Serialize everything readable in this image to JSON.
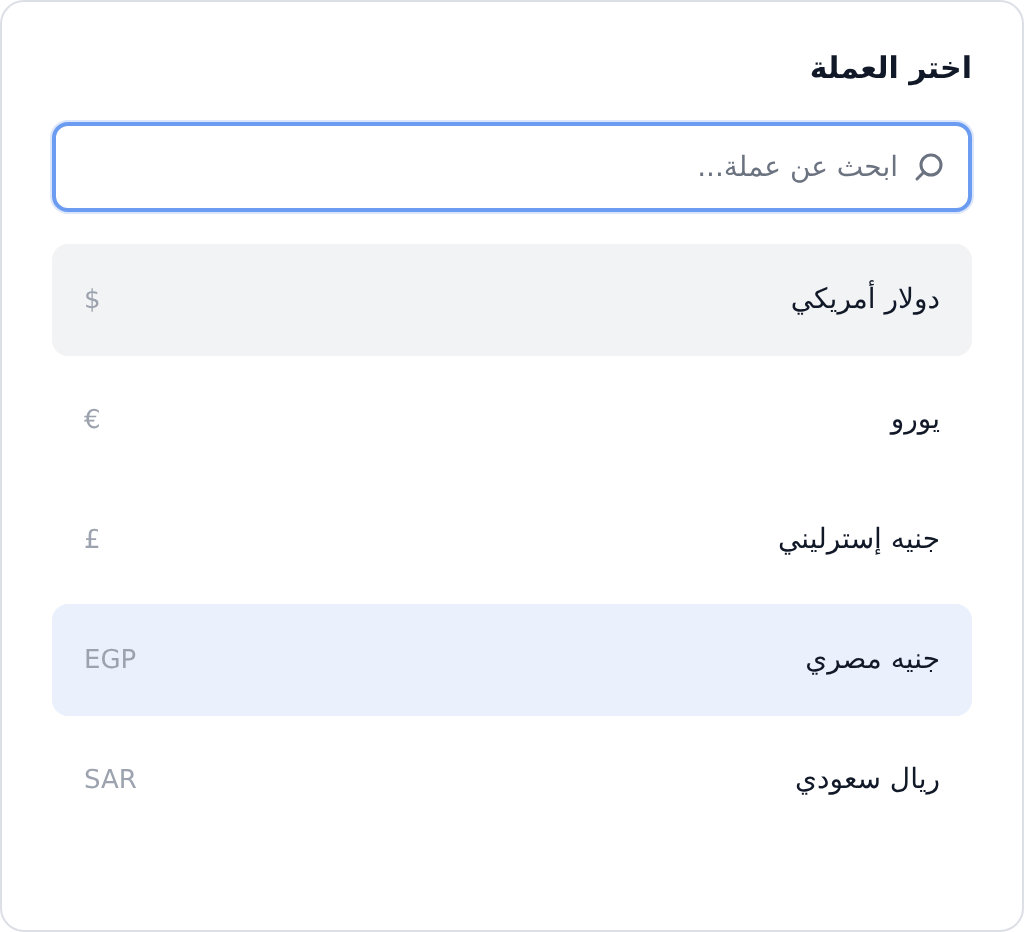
{
  "dialog": {
    "title": "اختر العملة"
  },
  "search": {
    "placeholder": "ابحث عن عملة..."
  },
  "currencies": [
    {
      "name": "دولار أمريكي",
      "symbol": "$",
      "selected": false,
      "hovered": true
    },
    {
      "name": "يورو",
      "symbol": "€",
      "selected": false,
      "hovered": false
    },
    {
      "name": "جنيه إسترليني",
      "symbol": "£",
      "selected": false,
      "hovered": false
    },
    {
      "name": "جنيه مصري",
      "symbol": "EGP",
      "selected": true,
      "hovered": false
    },
    {
      "name": "ريال سعودي",
      "symbol": "SAR",
      "selected": false,
      "hovered": false
    }
  ]
}
